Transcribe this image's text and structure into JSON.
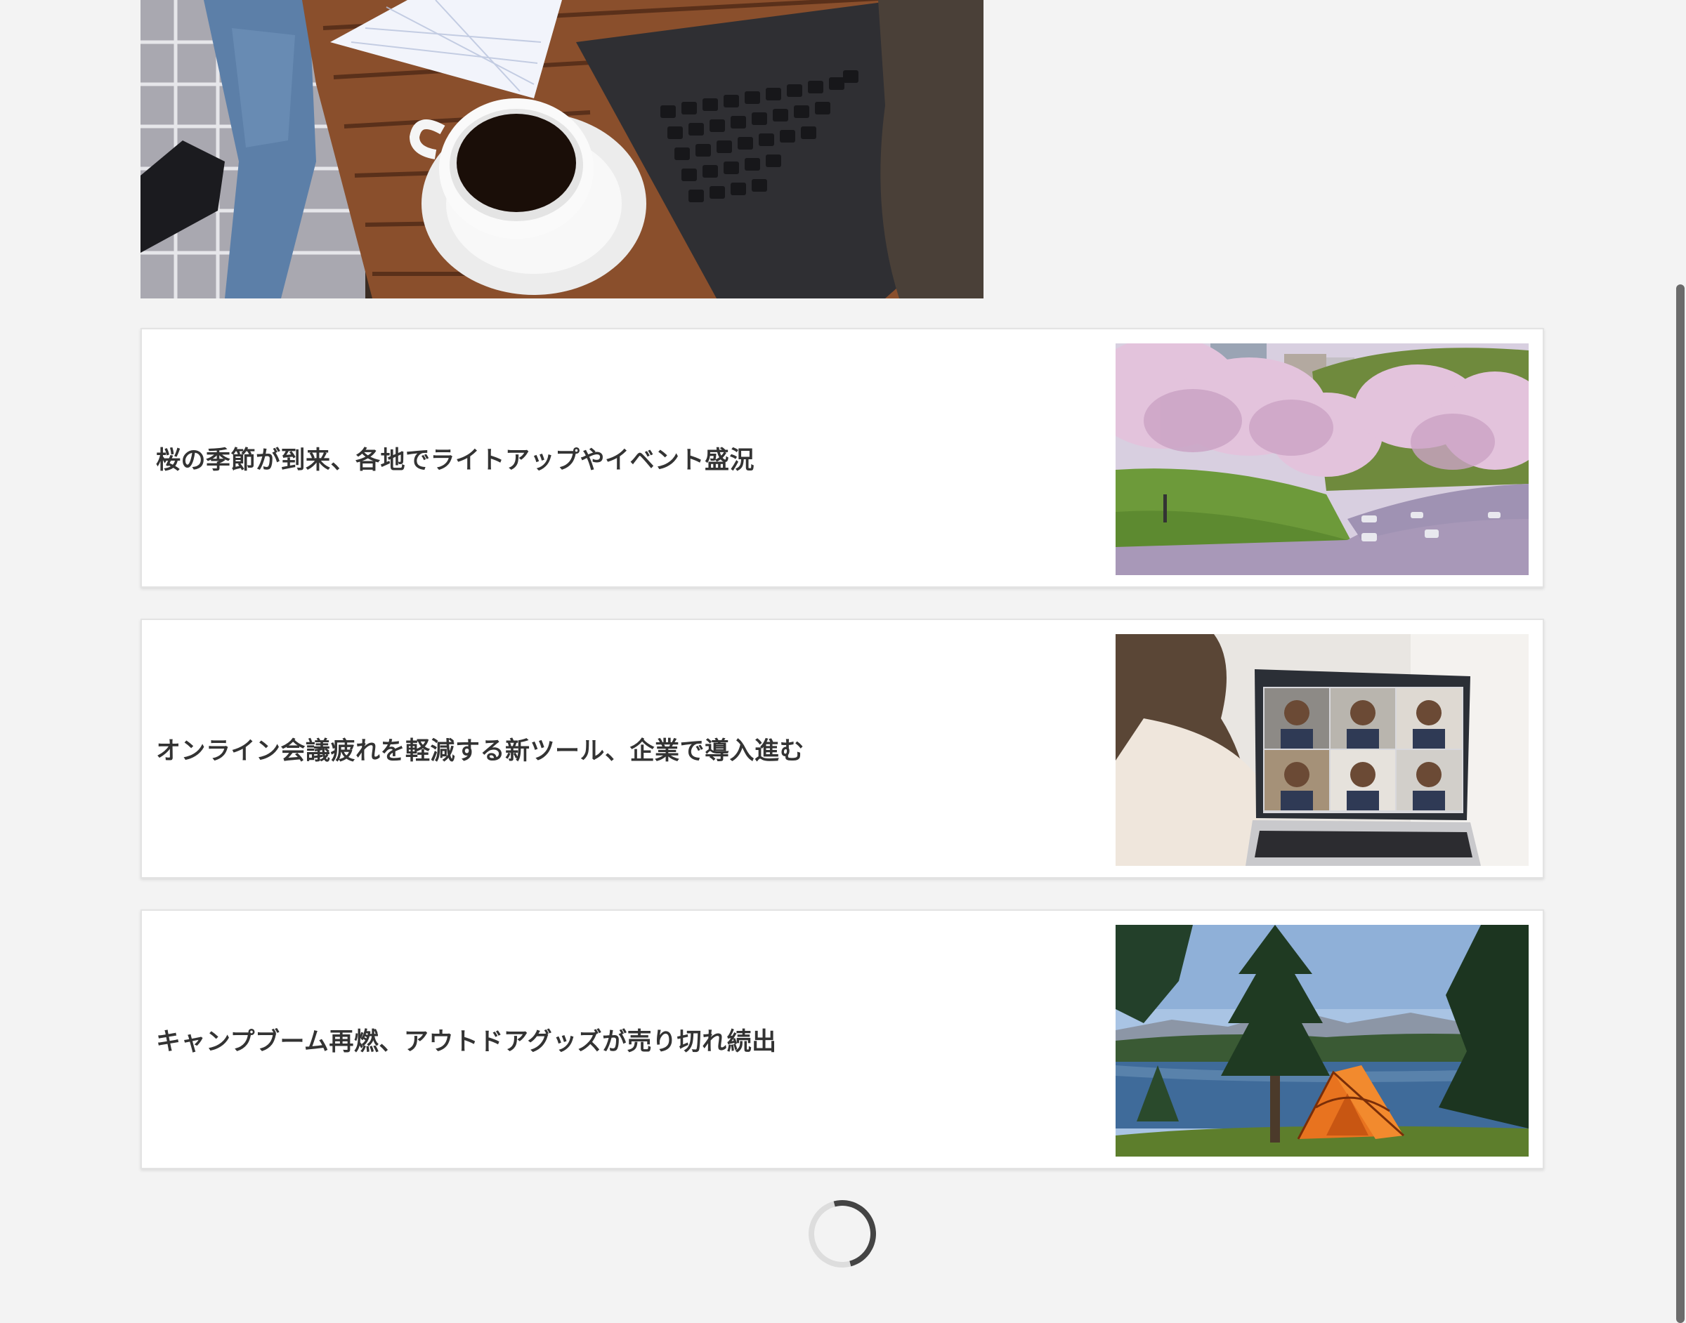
{
  "hero": {
    "image": "laptop-coffee-photo"
  },
  "articles": [
    {
      "title": "桜の季節が到来、各地でライトアップやイベント盛況",
      "thumbnail": "cherry-blossom-moat-photo"
    },
    {
      "title": "オンライン会議疲れを軽減する新ツール、企業で導入進む",
      "thumbnail": "video-conference-laptop-photo"
    },
    {
      "title": "キャンプブーム再燃、アウトドアグッズが売り切れ続出",
      "thumbnail": "camping-tent-lake-photo"
    }
  ],
  "loading": {
    "indicator": "spinner-icon"
  },
  "colors": {
    "page_background": "#f3f3f3",
    "card_background": "#ffffff",
    "title_text": "#333333",
    "spinner_active": "#444444"
  }
}
